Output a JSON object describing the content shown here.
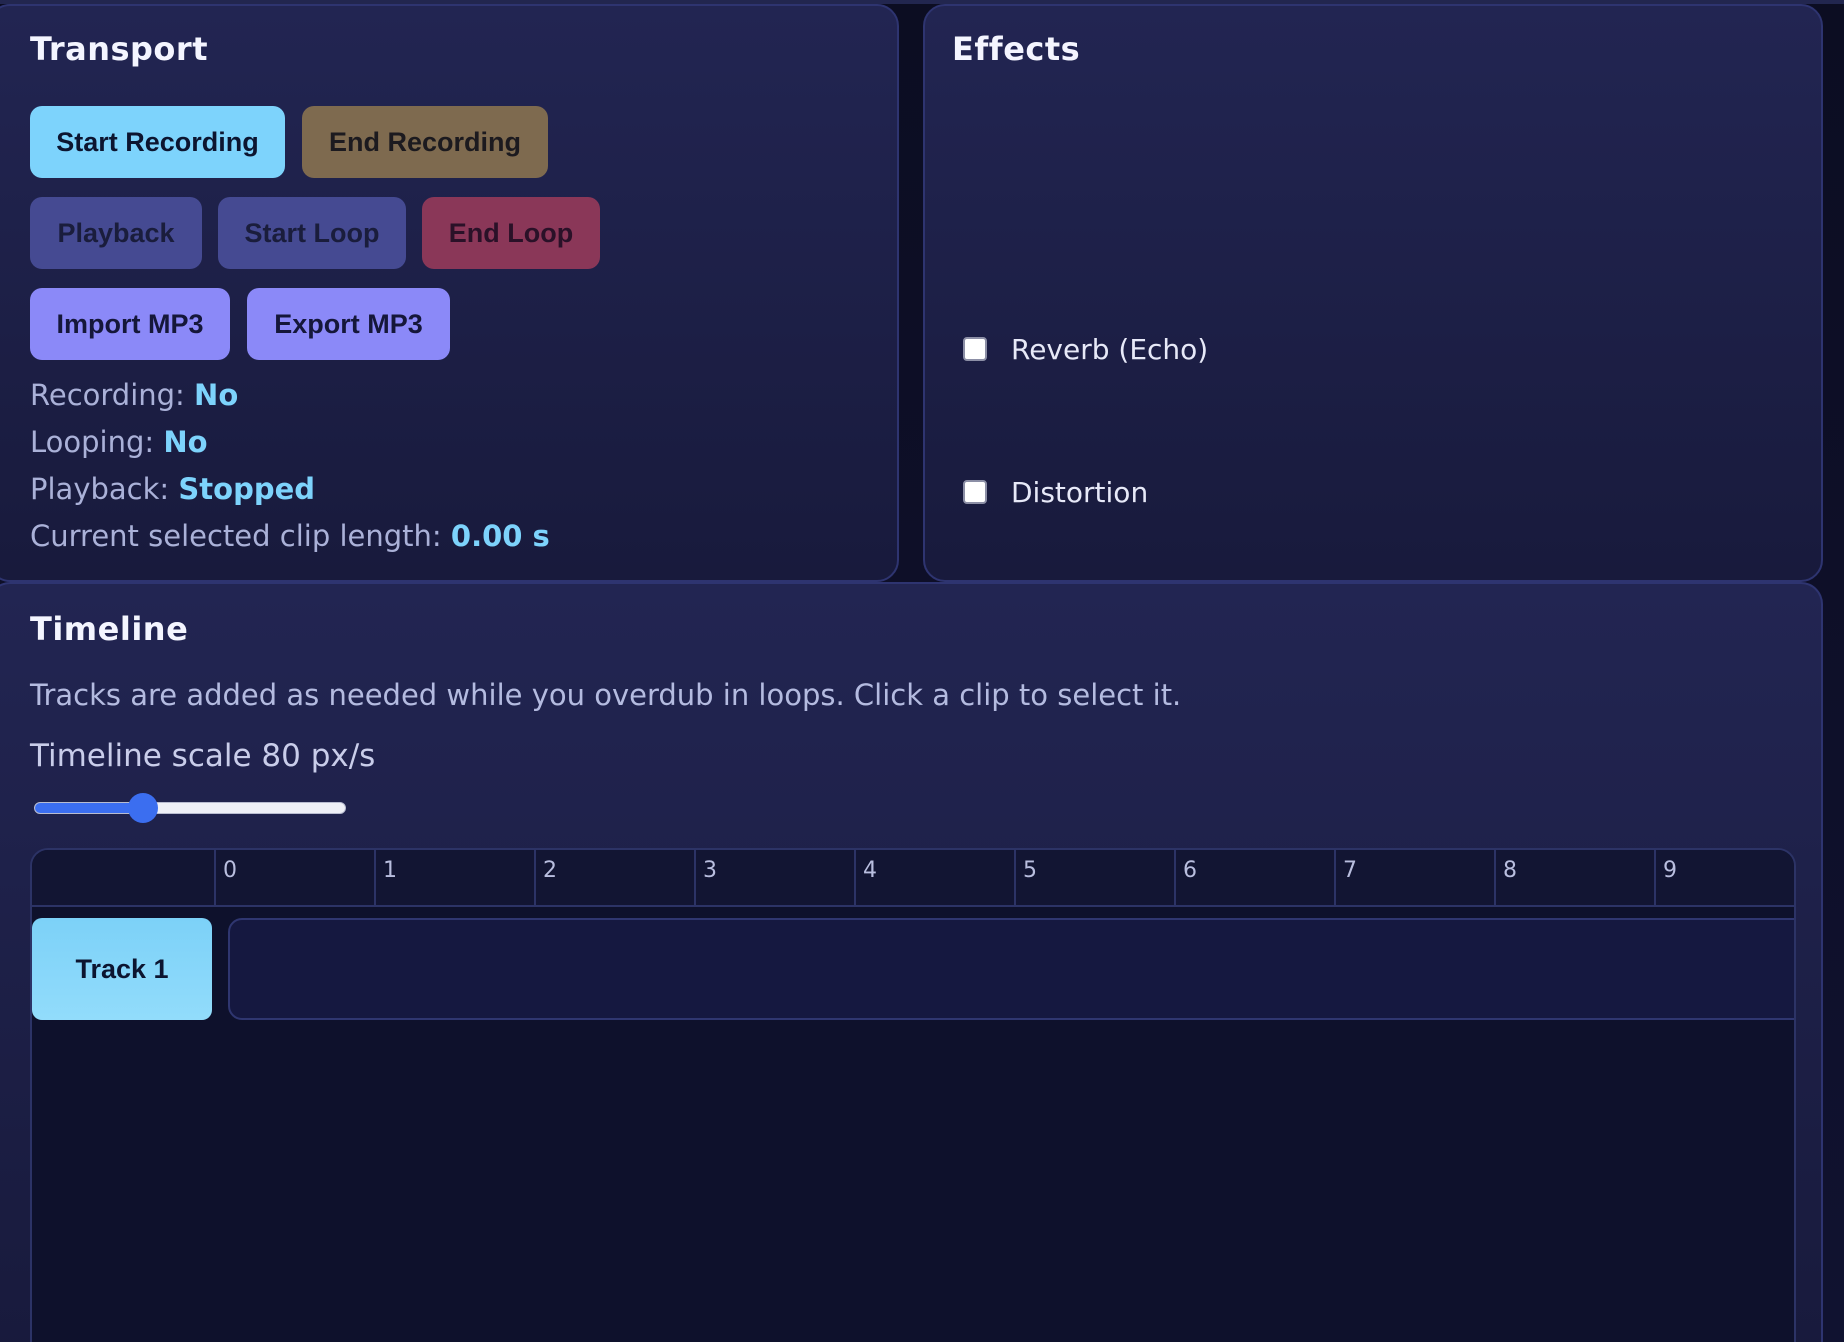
{
  "transport": {
    "title": "Transport",
    "buttons": {
      "start_recording": "Start Recording",
      "end_recording": "End Recording",
      "playback": "Playback",
      "start_loop": "Start Loop",
      "end_loop": "End Loop",
      "import_mp3": "Import MP3",
      "export_mp3": "Export MP3"
    },
    "status": {
      "recording_label": "Recording:",
      "recording_value": "No",
      "looping_label": "Looping:",
      "looping_value": "No",
      "playback_label": "Playback:",
      "playback_value": "Stopped",
      "clip_length_label": "Current selected clip length:",
      "clip_length_value": "0.00 s"
    }
  },
  "effects": {
    "title": "Effects",
    "items": [
      {
        "label": "Reverb (Echo)",
        "checked": false
      },
      {
        "label": "Distortion",
        "checked": false
      }
    ]
  },
  "timeline": {
    "title": "Timeline",
    "hint": "Tracks are added as needed while you overdub in loops. Click a clip to select it.",
    "scale_label": "Timeline scale 80 px/s",
    "scale_value": 80,
    "scale_fraction": 0.35,
    "ruler_ticks": [
      "0",
      "1",
      "2",
      "3",
      "4",
      "5",
      "6",
      "7",
      "8",
      "9"
    ],
    "tracks": [
      {
        "label": "Track 1"
      }
    ]
  },
  "colors": {
    "background": "#0b0c1e",
    "panel": "#222552",
    "accent_cyan": "#7dd3fc",
    "accent_violet": "#8b89f8",
    "slider_blue": "#3b6ef0"
  }
}
